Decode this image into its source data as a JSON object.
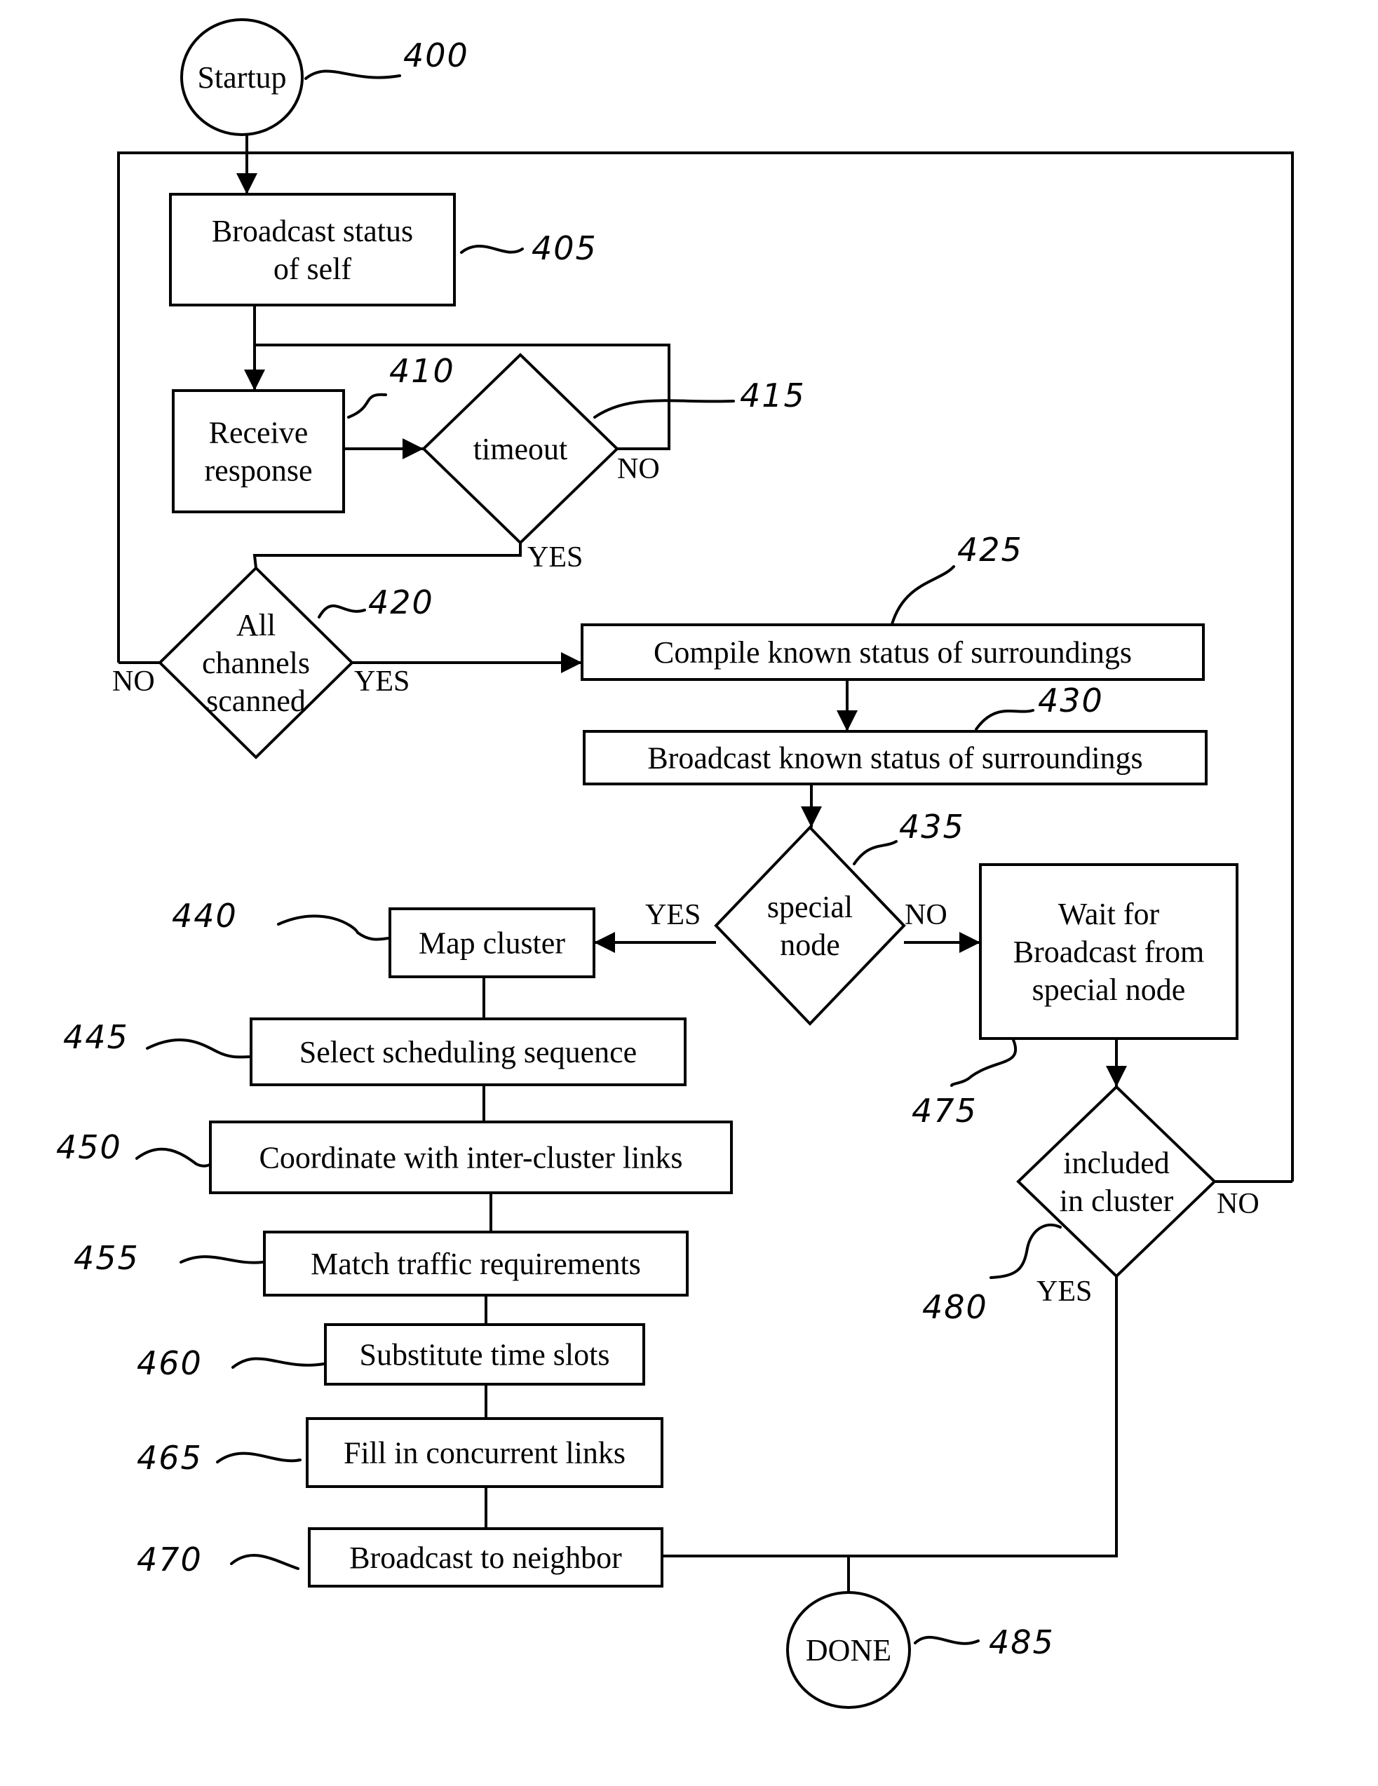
{
  "figure": {
    "type": "flowchart",
    "nodes": {
      "startup": {
        "ref": "400",
        "lines": [
          "Startup"
        ],
        "shape": "terminal"
      },
      "broadcast_self": {
        "ref": "405",
        "lines": [
          "Broadcast status",
          "of self"
        ],
        "shape": "process"
      },
      "receive_response": {
        "ref": "410",
        "lines": [
          "Receive",
          "response"
        ],
        "shape": "process"
      },
      "timeout": {
        "ref": "415",
        "lines": [
          "timeout"
        ],
        "shape": "decision"
      },
      "all_channels": {
        "ref": "420",
        "lines": [
          "All",
          "channels",
          "scanned"
        ],
        "shape": "decision"
      },
      "compile_status": {
        "ref": "425",
        "lines": [
          "Compile known status of surroundings"
        ],
        "shape": "process"
      },
      "broadcast_known": {
        "ref": "430",
        "lines": [
          "Broadcast known status of surroundings"
        ],
        "shape": "process"
      },
      "special_node": {
        "ref": "435",
        "lines": [
          "special",
          "node"
        ],
        "shape": "decision"
      },
      "map_cluster": {
        "ref": "440",
        "lines": [
          "Map cluster"
        ],
        "shape": "process"
      },
      "select_sequence": {
        "ref": "445",
        "lines": [
          "Select scheduling sequence"
        ],
        "shape": "process"
      },
      "coordinate_links": {
        "ref": "450",
        "lines": [
          "Coordinate with inter-cluster links"
        ],
        "shape": "process"
      },
      "match_traffic": {
        "ref": "455",
        "lines": [
          "Match traffic requirements"
        ],
        "shape": "process"
      },
      "substitute_slots": {
        "ref": "460",
        "lines": [
          "Substitute time slots"
        ],
        "shape": "process"
      },
      "fill_links": {
        "ref": "465",
        "lines": [
          "Fill in concurrent links"
        ],
        "shape": "process"
      },
      "broadcast_neighbor": {
        "ref": "470",
        "lines": [
          "Broadcast to neighbor"
        ],
        "shape": "process"
      },
      "wait_broadcast": {
        "ref": "475",
        "lines": [
          "Wait for",
          "Broadcast from",
          "special node"
        ],
        "shape": "process"
      },
      "included_cluster": {
        "ref": "480",
        "lines": [
          "included",
          "in cluster"
        ],
        "shape": "decision"
      },
      "done": {
        "ref": "485",
        "lines": [
          "DONE"
        ],
        "shape": "terminal"
      }
    },
    "branch_labels": {
      "timeout_no": "NO",
      "timeout_yes": "YES",
      "channels_no": "NO",
      "channels_yes": "YES",
      "special_yes": "YES",
      "special_no": "NO",
      "included_no": "NO",
      "included_yes": "YES"
    },
    "edges": [
      {
        "from": "startup",
        "to": "broadcast_self"
      },
      {
        "from": "broadcast_self",
        "to": "receive_response"
      },
      {
        "from": "receive_response",
        "to": "timeout"
      },
      {
        "from": "timeout",
        "to": "receive_response",
        "label": "NO"
      },
      {
        "from": "timeout",
        "to": "all_channels",
        "label": "YES"
      },
      {
        "from": "all_channels",
        "to": "broadcast_self",
        "label": "NO"
      },
      {
        "from": "all_channels",
        "to": "compile_status",
        "label": "YES"
      },
      {
        "from": "compile_status",
        "to": "broadcast_known"
      },
      {
        "from": "broadcast_known",
        "to": "special_node"
      },
      {
        "from": "special_node",
        "to": "map_cluster",
        "label": "YES"
      },
      {
        "from": "special_node",
        "to": "wait_broadcast",
        "label": "NO"
      },
      {
        "from": "map_cluster",
        "to": "select_sequence"
      },
      {
        "from": "select_sequence",
        "to": "coordinate_links"
      },
      {
        "from": "coordinate_links",
        "to": "match_traffic"
      },
      {
        "from": "match_traffic",
        "to": "substitute_slots"
      },
      {
        "from": "substitute_slots",
        "to": "fill_links"
      },
      {
        "from": "fill_links",
        "to": "broadcast_neighbor"
      },
      {
        "from": "broadcast_neighbor",
        "to": "done"
      },
      {
        "from": "wait_broadcast",
        "to": "included_cluster"
      },
      {
        "from": "included_cluster",
        "to": "broadcast_self",
        "label": "NO"
      },
      {
        "from": "included_cluster",
        "to": "done",
        "label": "YES"
      }
    ]
  }
}
